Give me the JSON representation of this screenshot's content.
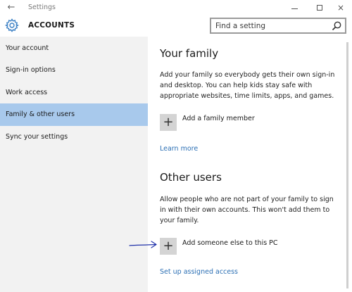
{
  "window": {
    "back_glyph": "←",
    "title": "Settings",
    "close_glyph": "×"
  },
  "header": {
    "icon": "gear-icon",
    "title": "ACCOUNTS"
  },
  "search": {
    "placeholder": "Find a setting",
    "icon": "search-icon"
  },
  "sidebar": {
    "items": [
      {
        "label": "Your account",
        "selected": false
      },
      {
        "label": "Sign-in options",
        "selected": false
      },
      {
        "label": "Work access",
        "selected": false
      },
      {
        "label": "Family & other users",
        "selected": true
      },
      {
        "label": "Sync your settings",
        "selected": false
      }
    ]
  },
  "family": {
    "title": "Your family",
    "description": "Add your family so everybody gets their own sign-in and desktop. You can help kids stay safe with appropriate websites, time limits, apps, and games.",
    "add_label": "Add a family member",
    "learn_more": "Learn more"
  },
  "other_users": {
    "title": "Other users",
    "description": "Allow people who are not part of your family to sign in with their own accounts. This won't add them to your family.",
    "add_label": "Add someone else to this PC",
    "assigned_access": "Set up assigned access"
  },
  "colors": {
    "selected_nav": "#a8c9ec",
    "sidebar_bg": "#f2f2f2",
    "link": "#2b6fb4",
    "annotation_arrow": "#2233aa"
  }
}
